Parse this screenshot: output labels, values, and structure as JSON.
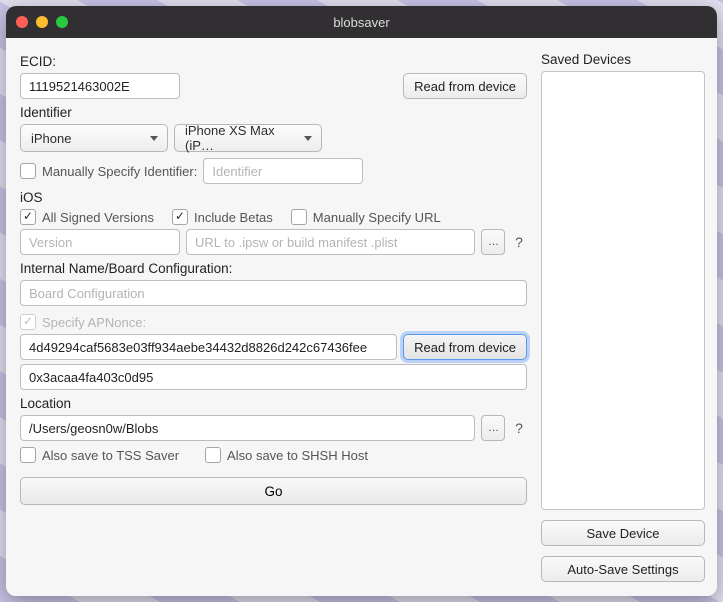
{
  "window": {
    "title": "blobsaver"
  },
  "ecid": {
    "label": "ECID:",
    "value": "1119521463002E"
  },
  "readFromDevice": "Read from device",
  "identifier": {
    "label": "Identifier",
    "deviceType": "iPhone",
    "model": "iPhone XS Max (iP…",
    "manualLabel": "Manually Specify Identifier:",
    "manualPlaceholder": "Identifier"
  },
  "ios": {
    "label": "iOS",
    "allSigned": "All Signed Versions",
    "includeBetas": "Include Betas",
    "manualUrlLabel": "Manually Specify URL",
    "versionPlaceholder": "Version",
    "urlPlaceholder": "URL to .ipsw or build manifest .plist"
  },
  "board": {
    "label": "Internal Name/Board Configuration:",
    "placeholder": "Board Configuration"
  },
  "apnonce": {
    "label": "Specify APNonce:",
    "value": "4d49294caf5683e03ff934aebe34432d8826d242c67436fee",
    "generator": "0x3acaa4fa403c0d95"
  },
  "location": {
    "label": "Location",
    "value": "/Users/geosn0w/Blobs"
  },
  "alsoSave": {
    "tss": "Also save to TSS Saver",
    "shsh": "Also save to SHSH Host"
  },
  "go": "Go",
  "side": {
    "title": "Saved Devices",
    "save": "Save Device",
    "auto": "Auto-Save Settings"
  }
}
